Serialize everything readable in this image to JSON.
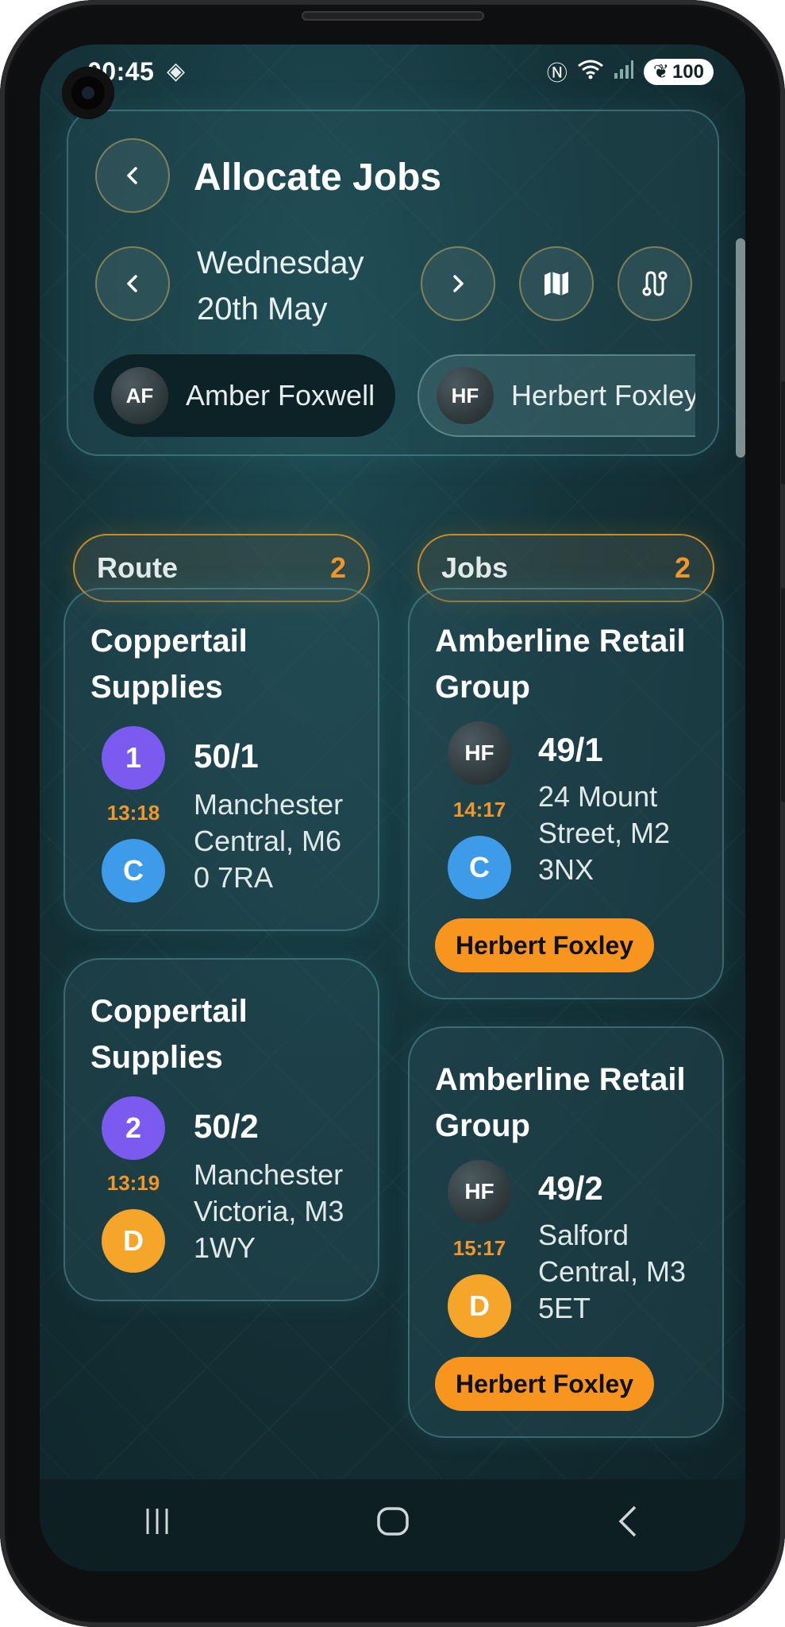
{
  "status_bar": {
    "time": "00:45",
    "battery": "100"
  },
  "header": {
    "title": "Allocate Jobs",
    "date_line1": "Wednesday",
    "date_line2": "20th May"
  },
  "people": [
    {
      "initials": "AF",
      "name": "Amber Foxwell",
      "selected": true
    },
    {
      "initials": "HF",
      "name": "Herbert Foxley",
      "selected": false
    }
  ],
  "columns": {
    "route": {
      "label": "Route",
      "count": "2"
    },
    "jobs": {
      "label": "Jobs",
      "count": "2"
    }
  },
  "route_cards": [
    {
      "company": "Coppertail Supplies",
      "stop": "1",
      "time": "13:18",
      "type": "C",
      "ref": "50/1",
      "address": "Manchester Central, M60 7RA"
    },
    {
      "company": "Coppertail Supplies",
      "stop": "2",
      "time": "13:19",
      "type": "D",
      "ref": "50/2",
      "address": "Manchester Victoria, M3 1WY"
    }
  ],
  "job_cards": [
    {
      "company": "Amberline Retail Group",
      "initials": "HF",
      "time": "14:17",
      "type": "C",
      "ref": "49/1",
      "address": "24 Mount Street, M2 3NX",
      "assignee": "Herbert Foxley"
    },
    {
      "company": "Amberline Retail Group",
      "initials": "HF",
      "time": "15:17",
      "type": "D",
      "ref": "49/2",
      "address": "Salford Central, M3 5ET",
      "assignee": "Herbert Foxley"
    }
  ],
  "colors": {
    "accent": "#f0962b",
    "purple": "#7b5bef",
    "blue": "#3d9be9",
    "orange": "#f5a62a"
  }
}
